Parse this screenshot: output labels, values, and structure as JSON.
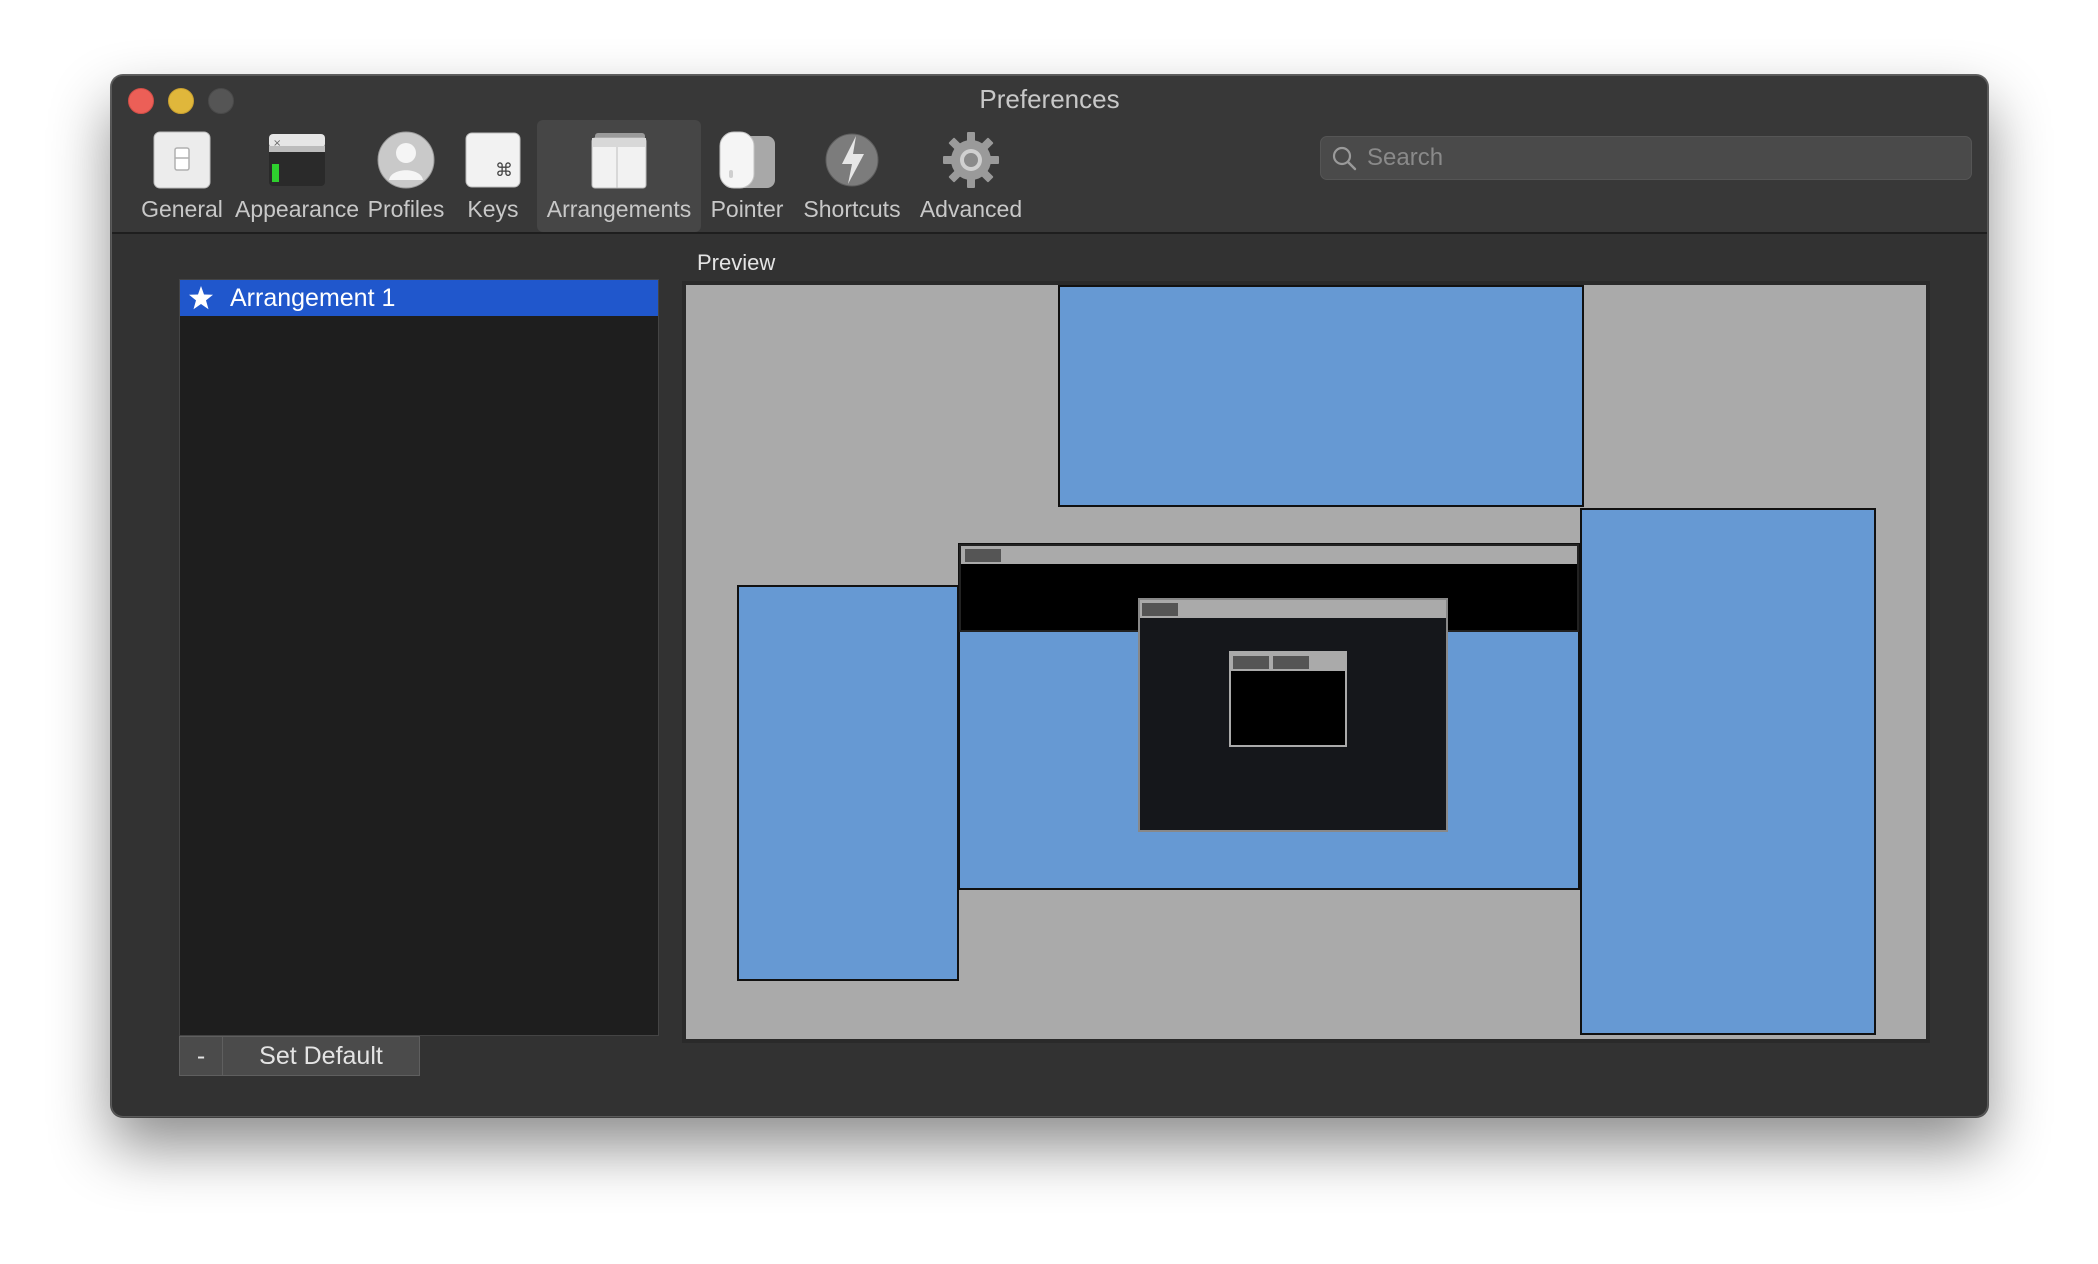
{
  "window": {
    "title": "Preferences"
  },
  "toolbar": {
    "items": [
      {
        "label": "General",
        "icon": "general-icon"
      },
      {
        "label": "Appearance",
        "icon": "appearance-icon"
      },
      {
        "label": "Profiles",
        "icon": "profiles-icon"
      },
      {
        "label": "Keys",
        "icon": "keys-icon"
      },
      {
        "label": "Arrangements",
        "icon": "arrangements-icon",
        "selected": true
      },
      {
        "label": "Pointer",
        "icon": "pointer-icon"
      },
      {
        "label": "Shortcuts",
        "icon": "shortcuts-icon"
      },
      {
        "label": "Advanced",
        "icon": "gear-icon"
      }
    ]
  },
  "search": {
    "placeholder": "Search",
    "value": ""
  },
  "arrangements": {
    "items": [
      {
        "label": "Arrangement 1",
        "default": true,
        "selected": true
      }
    ],
    "remove_label": "-",
    "set_default_label": "Set Default"
  },
  "preview": {
    "label": "Preview"
  },
  "colors": {
    "selection": "#2057cc",
    "screen": "#6699d3",
    "preview_bg": "#aaaaaa"
  }
}
